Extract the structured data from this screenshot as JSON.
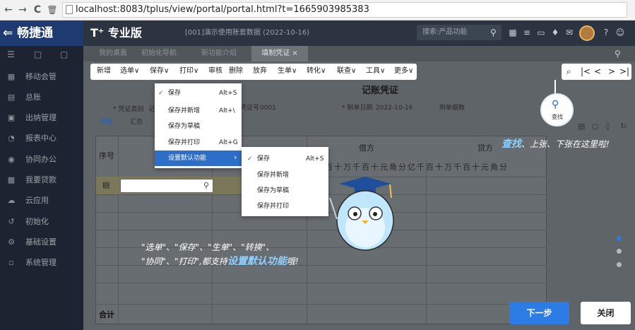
{
  "browser": {
    "back": "←",
    "forward": "→",
    "reload": "C",
    "trash": "🗑",
    "url": "localhost:8083/tplus/view/portal/portal.html?t=1665903985383"
  },
  "header": {
    "brand": "⇐ 畅捷通",
    "product": "T⁺ 专业版",
    "account": "[001]演示使用账套数据 (2022-10-16)",
    "search_placeholder": "搜索:产品功能"
  },
  "sidebar": {
    "items": [
      {
        "label": "移动会管",
        "icon": "mobile-icon"
      },
      {
        "label": "总账",
        "icon": "ledger-icon"
      },
      {
        "label": "出纳管理",
        "icon": "cashier-icon"
      },
      {
        "label": "报表中心",
        "icon": "report-icon"
      },
      {
        "label": "协同办公",
        "icon": "collab-icon"
      },
      {
        "label": "我要贷款",
        "icon": "loan-icon"
      },
      {
        "label": "云应用",
        "icon": "cloud-icon"
      },
      {
        "label": "初始化",
        "icon": "init-icon"
      },
      {
        "label": "基础设置",
        "icon": "settings-icon"
      },
      {
        "label": "系统管理",
        "icon": "system-icon"
      }
    ]
  },
  "tabs": [
    "我的桌面",
    "初始化导航",
    "新功能介绍",
    "填制凭证"
  ],
  "toolbar": [
    "新增",
    "选单∨",
    "保存∨",
    "打印∨",
    "审核",
    "删除",
    "放弃",
    "生单∨",
    "转化∨",
    "联查∨",
    "工具∨",
    "更多∨"
  ],
  "nav_buttons": [
    "⌕",
    "|<",
    "<",
    ">",
    ">|"
  ],
  "voucher": {
    "title": "记账凭证",
    "category_label": "* 凭证类别",
    "category_value": "记",
    "code_label": "凭证号",
    "code_value": "0001",
    "date_label": "* 制单日期",
    "date_value": "2022-10-16",
    "attach_label": "附单据数",
    "view_tabs": [
      "明细",
      "汇总"
    ],
    "col_seq": "序号",
    "col_debit": "借方",
    "col_credit": "贷方",
    "digits": "百十万千百十元角分亿千百十万千百十元角分",
    "total": "合计"
  },
  "menu1": {
    "items": [
      {
        "label": "保存",
        "shortcut": "Alt+S",
        "checked": "✓"
      },
      {
        "label": "保存并新增",
        "shortcut": "Alt+\\"
      },
      {
        "label": "保存为草稿",
        "shortcut": ""
      },
      {
        "label": "保存并打印",
        "shortcut": "Alt+G"
      },
      {
        "label": "设置默认功能",
        "shortcut": "›"
      }
    ]
  },
  "menu2": {
    "items": [
      {
        "label": "保存",
        "shortcut": "Alt+S",
        "checked": "✓"
      },
      {
        "label": "保存并新增",
        "shortcut": ""
      },
      {
        "label": "保存为草稿",
        "shortcut": ""
      },
      {
        "label": "保存并打印",
        "shortcut": ""
      }
    ]
  },
  "guide": {
    "find_label": "查找",
    "tip1_bold": "查找",
    "tip1_rest": "、上张、下张在这里啦!",
    "tip2": "\"选单\"、\"保存\"、\"生单\"、\"转换\"、",
    "tip3_pre": "\"协同\"、\"打印\",都支持",
    "tip3_bold": "设置默认功能",
    "tip3_post": "哦!",
    "next": "下一步",
    "close": "关闭"
  }
}
